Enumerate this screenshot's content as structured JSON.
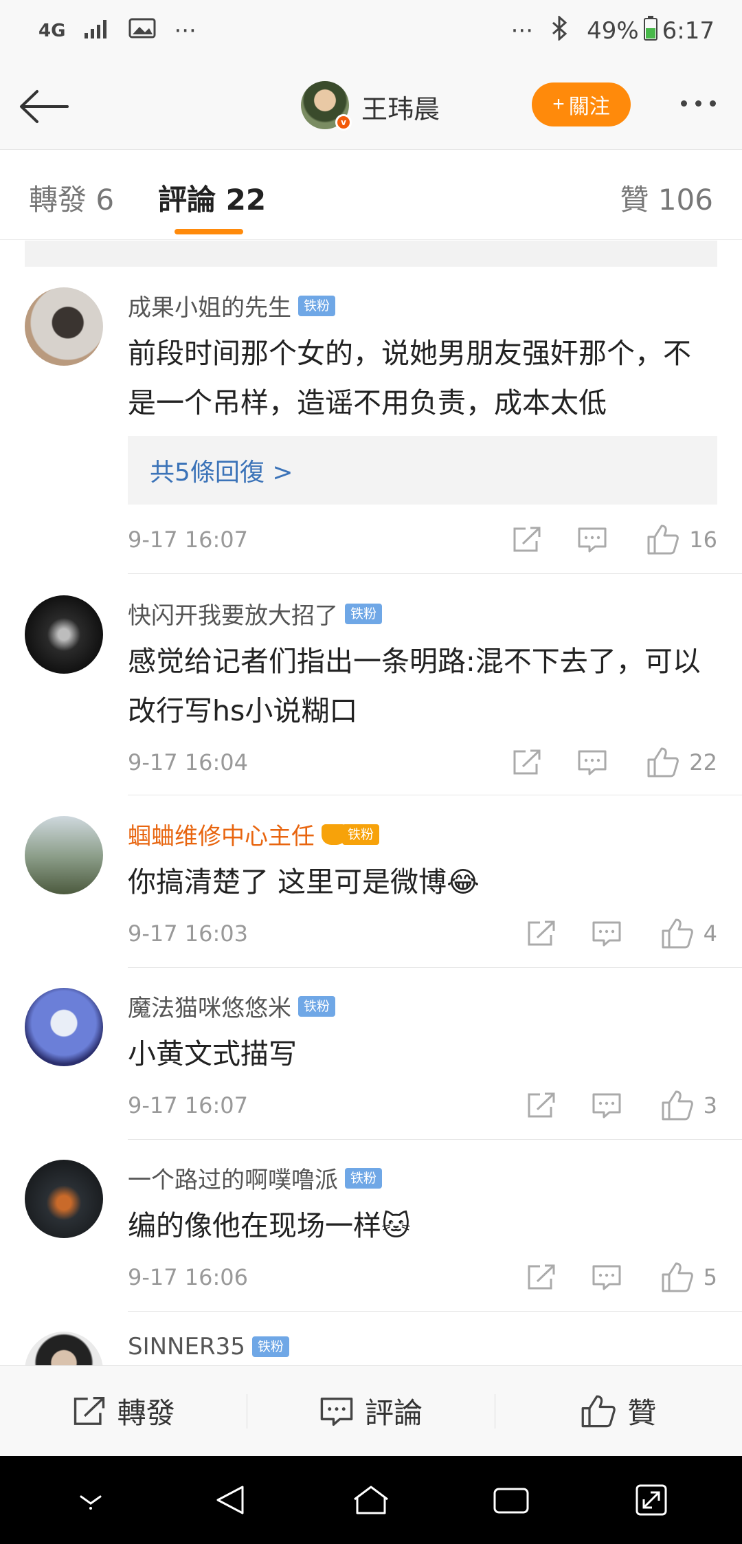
{
  "status_bar": {
    "network": "4G",
    "overflow": "···",
    "overflow_right": "···",
    "battery": "49%",
    "time": "6:17"
  },
  "header": {
    "user_name": "王玮晨",
    "follow_label": "關注",
    "follow_plus": "+"
  },
  "tabs": [
    {
      "label": "轉發 6"
    },
    {
      "label": "評論 22"
    },
    {
      "label": "贊 106"
    }
  ],
  "comments": [
    {
      "name": "成果小姐的先生",
      "badge": "铁粉",
      "text": "前段时间那个女的，说她男朋友强奸那个，不是一个吊样，造谣不用负责，成本太低",
      "reply_summary": "共5條回復 >",
      "time": "9-17 16:07",
      "likes": "16"
    },
    {
      "name": "快闪开我要放大招了",
      "badge": "铁粉",
      "text": "感觉给记者们指出一条明路:混不下去了，可以改行写hs小说糊口",
      "time": "9-17 16:04",
      "likes": "22"
    },
    {
      "name": "蝈蛐维修中心主任",
      "badge": "铁粉",
      "text": "你搞清楚了 这里可是微博😂",
      "time": "9-17 16:03",
      "likes": "4"
    },
    {
      "name": "魔法猫咪悠悠米",
      "badge": "铁粉",
      "text": "小黄文式描写",
      "time": "9-17 16:07",
      "likes": "3"
    },
    {
      "name": "一个路过的啊噗噜派",
      "badge": "铁粉",
      "text": "编的像他在现场一样🐱",
      "time": "9-17 16:06",
      "likes": "5"
    },
    {
      "name": "SINNER35",
      "badge": "铁粉"
    }
  ],
  "bottom_bar": {
    "repost_label": "轉發",
    "comment_label": "評論",
    "like_label": "贊"
  },
  "colors": {
    "accent": "#ff8a0b",
    "link": "#3b73b8",
    "badge": "#6fa7e6",
    "vip_name": "#e8650f",
    "verified": "#f25a0a"
  },
  "icons": {
    "status": [
      "signal-icon",
      "image-icon",
      "bluetooth-icon",
      "battery-icon"
    ],
    "header": [
      "back-arrow-icon",
      "more-dots-icon"
    ],
    "actions": [
      "share-icon",
      "comment-icon",
      "like-icon"
    ],
    "nav": [
      "nav-collapse-icon",
      "nav-back-icon",
      "nav-home-icon",
      "nav-recents-icon",
      "nav-fullscreen-icon"
    ]
  }
}
